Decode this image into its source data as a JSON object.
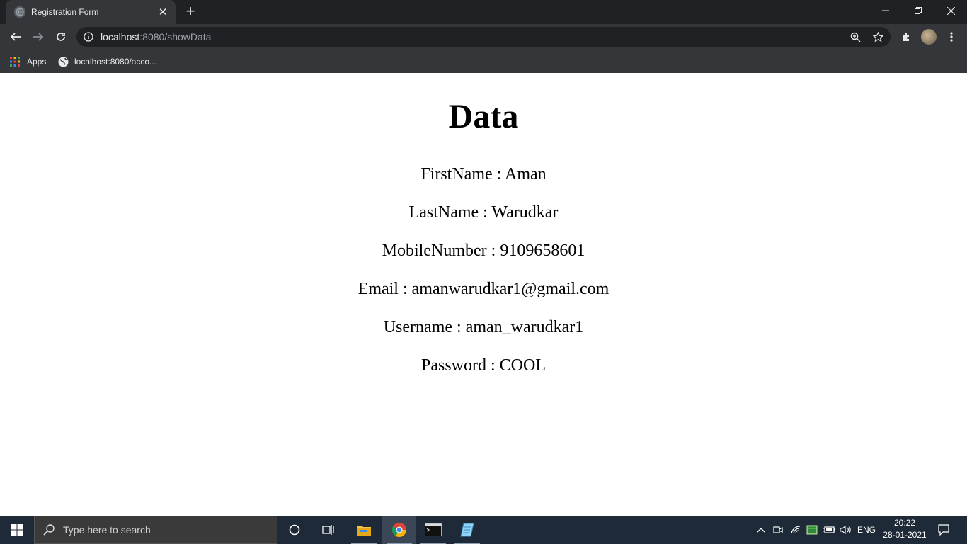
{
  "browser": {
    "tab_title": "Registration Form",
    "url_host": "localhost",
    "url_rest": ":8080/showData",
    "bookmarks": [
      {
        "label": "Apps",
        "icon": "apps-grid-icon"
      },
      {
        "label": "localhost:8080/acco...",
        "icon": "globe-icon"
      }
    ]
  },
  "page": {
    "heading": "Data",
    "fields": [
      {
        "label": "FirstName",
        "value": "Aman"
      },
      {
        "label": "LastName",
        "value": "Warudkar"
      },
      {
        "label": "MobileNumber",
        "value": "9109658601"
      },
      {
        "label": "Email",
        "value": "amanwarudkar1@gmail.com"
      },
      {
        "label": "Username",
        "value": "aman_warudkar1"
      },
      {
        "label": "Password",
        "value": "COOL"
      }
    ]
  },
  "taskbar": {
    "search_placeholder": "Type here to search",
    "language": "ENG",
    "time": "20:22",
    "date": "28-01-2021"
  },
  "colors": {
    "tabstrip": "#202124",
    "toolbar": "#35363a",
    "taskbar": "#1f2a38"
  }
}
